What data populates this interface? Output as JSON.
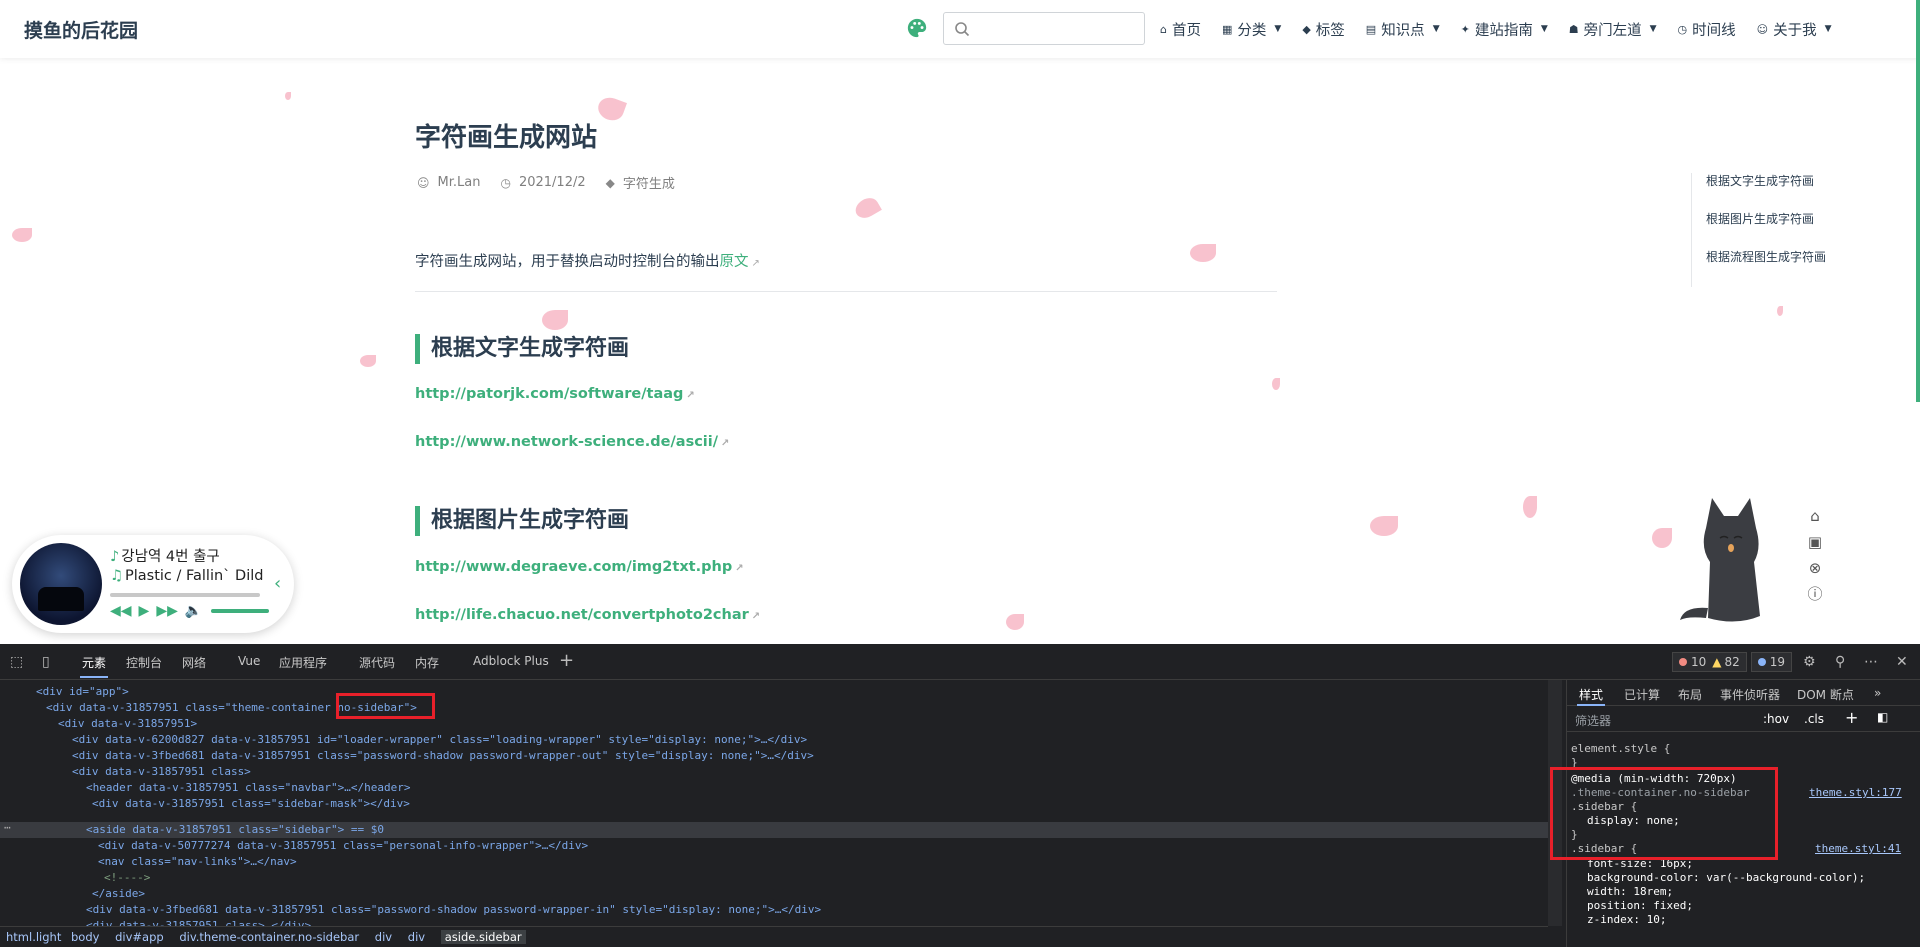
{
  "navbar": {
    "site_name": "摸鱼的后花园",
    "items": [
      {
        "icon": "home-icon",
        "label": "首页",
        "dropdown": false
      },
      {
        "icon": "grid-icon",
        "label": "分类",
        "dropdown": true
      },
      {
        "icon": "tag-icon",
        "label": "标签",
        "dropdown": false
      },
      {
        "icon": "book-icon",
        "label": "知识点",
        "dropdown": true
      },
      {
        "icon": "bird-icon",
        "label": "建站指南",
        "dropdown": true
      },
      {
        "icon": "robot-icon",
        "label": "旁门左道",
        "dropdown": true
      },
      {
        "icon": "clock-icon",
        "label": "时间线",
        "dropdown": false
      },
      {
        "icon": "user-icon",
        "label": "关于我",
        "dropdown": true
      }
    ],
    "accent": "#3eaf7c"
  },
  "article": {
    "title": "字符画生成网站",
    "author": "Mr.Lan",
    "date": "2021/12/2",
    "tag": "字符生成",
    "intro_text": "字符画生成网站，用于替换启动时控制台的输出",
    "intro_link": "原文",
    "sections": [
      {
        "heading": "根据文字生成字符画",
        "links": [
          "http://patorjk.com/software/taag",
          "http://www.network-science.de/ascii/"
        ]
      },
      {
        "heading": "根据图片生成字符画",
        "links": [
          "http://www.degraeve.com/img2txt.php",
          "http://life.chacuo.net/convertphoto2char"
        ]
      }
    ]
  },
  "toc": [
    "根据文字生成字符画",
    "根据图片生成字符画",
    "根据流程图生成字符画"
  ],
  "player": {
    "song": "강남역 4번 출구",
    "artist": "Plastic / Fallin` Dild"
  },
  "devtools": {
    "tabs": [
      "元素",
      "控制台",
      "网络",
      "Vue",
      "应用程序",
      "源代码",
      "内存",
      "Adblock Plus"
    ],
    "errors": "10",
    "warnings": "82",
    "info": "19",
    "dom_lines": [
      "<div id=\"app\">",
      "<div data-v-31857951 class=\"theme-container no-sidebar\">",
      "<div data-v-31857951>",
      "<div data-v-6200d827 data-v-31857951 id=\"loader-wrapper\" class=\"loading-wrapper\" style=\"display: none;\">…</div>",
      "<div data-v-3fbed681 data-v-31857951 class=\"password-shadow password-wrapper-out\" style=\"display: none;\">…</div>",
      "<div data-v-31857951 class>",
      "<header data-v-31857951 class=\"navbar\">…</header>",
      "<div data-v-31857951 class=\"sidebar-mask\"></div>",
      "<aside data-v-31857951 class=\"sidebar\"> == $0",
      "<div data-v-50777274 data-v-31857951 class=\"personal-info-wrapper\">…</div>",
      "<nav class=\"nav-links\">…</nav>",
      "<!---->",
      "</aside>",
      "<div data-v-3fbed681 data-v-31857951 class=\"password-shadow password-wrapper-in\" style=\"display: none;\">…</div>",
      "<div data-v-31857951 class>…</div>"
    ],
    "styles_tabs": [
      "样式",
      "已计算",
      "布局",
      "事件侦听器",
      "DOM 断点"
    ],
    "filter_placeholder": "筛选器",
    "hov": ":hov",
    "cls": ".cls",
    "style_rules": [
      "element.style {",
      "}",
      "@media (min-width: 720px)",
      ".theme-container.no-sidebar",
      ".sidebar {",
      "display: none;",
      "}",
      ".sidebar {",
      "font-size: 16px;",
      "background-color: var(--background-color);",
      "width: 18rem;",
      "position: fixed;",
      "z-index: 10;"
    ],
    "source1": "theme.styl:177",
    "source2": "theme.styl:41",
    "breadcrumb": [
      "html.light",
      "body",
      "div#app",
      "div.theme-container.no-sidebar",
      "div",
      "div",
      "aside.sidebar"
    ]
  }
}
